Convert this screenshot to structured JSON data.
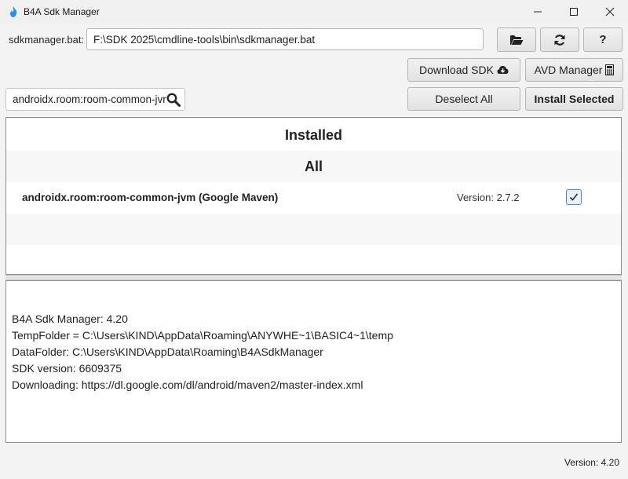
{
  "window": {
    "title": "B4A Sdk Manager",
    "controls": {
      "minimize": "—",
      "maximize": "☐",
      "close": "✕"
    }
  },
  "sdk": {
    "label": "sdkmanager.bat:",
    "path": "F:\\SDK 2025\\cmdline-tools\\bin\\sdkmanager.bat"
  },
  "toolbar": {
    "open_icon": "folder-open-icon",
    "refresh_icon": "refresh-icon",
    "help_label": "?",
    "download_sdk_label": "Download SDK",
    "download_icon": "cloud-download-icon",
    "avd_manager_label": "AVD Manager",
    "avd_icon": "calculator-icon",
    "deselect_all_label": "Deselect All",
    "install_selected_label": "Install Selected"
  },
  "search": {
    "value": "androidx.room:room-common-jvm",
    "icon": "search-icon"
  },
  "list": {
    "installed_header": "Installed",
    "all_header": "All",
    "packages": [
      {
        "name": "androidx.room:room-common-jvm (Google Maven)",
        "version": "Version: 2.7.2",
        "checked": true
      }
    ]
  },
  "log": {
    "lines": [
      "B4A Sdk Manager: 4.20",
      "TempFolder = C:\\Users\\KIND\\AppData\\Roaming\\ANYWHE~1\\BASIC4~1\\temp",
      "DataFolder: C:\\Users\\KIND\\AppData\\Roaming\\B4ASdkManager",
      "SDK version: 6609375",
      "Downloading: https://dl.google.com/dl/android/maven2/master-index.xml"
    ]
  },
  "footer": {
    "version": "Version: 4.20"
  },
  "colors": {
    "accent": "#3f8ed6",
    "app_icon": "#1e90ff"
  }
}
